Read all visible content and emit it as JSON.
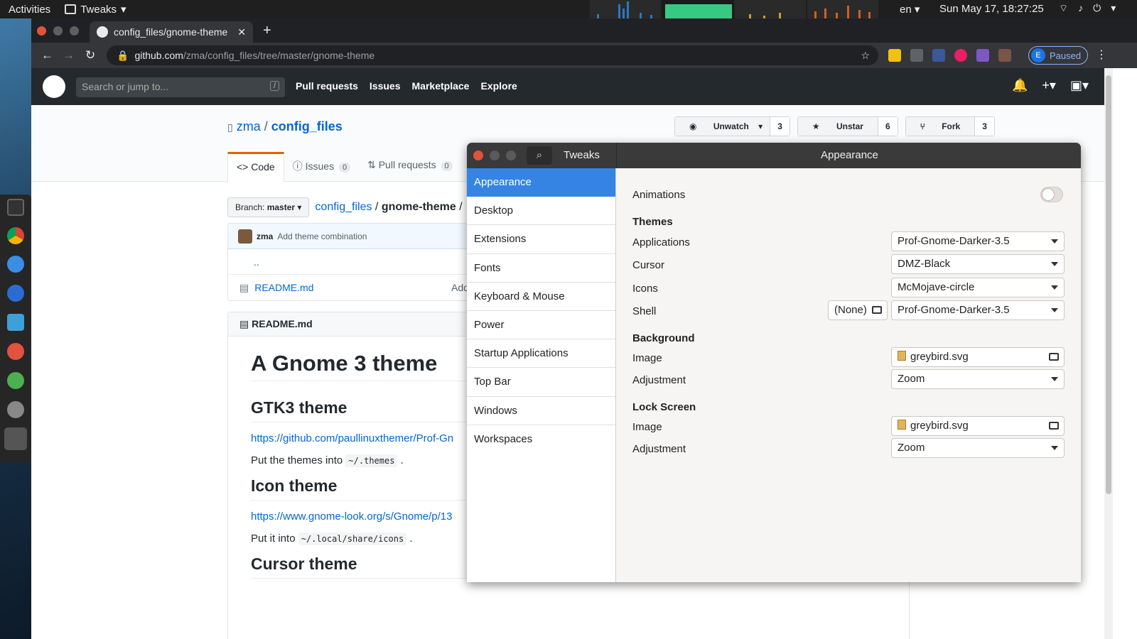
{
  "topbar": {
    "activities": "Activities",
    "app": "Tweaks",
    "lang": "en ▾",
    "clock": "Sun May 17, 18:27:25"
  },
  "chrome": {
    "tab_title": "config_files/gnome-theme",
    "url_host": "github.com",
    "url_path": "/zma/config_files/tree/master/gnome-theme",
    "profile_initial": "E",
    "profile_status": "Paused"
  },
  "github": {
    "search_placeholder": "Search or jump to...",
    "search_key": "/",
    "nav": [
      "Pull requests",
      "Issues",
      "Marketplace",
      "Explore"
    ],
    "owner": "zma",
    "repo": "config_files",
    "watch_label": "Unwatch",
    "watch_count": "3",
    "star_label": "Unstar",
    "star_count": "6",
    "fork_label": "Fork",
    "fork_count": "3",
    "tabs": [
      {
        "label": "Code",
        "count": ""
      },
      {
        "label": "Issues",
        "count": "0"
      },
      {
        "label": "Pull requests",
        "count": "0"
      }
    ],
    "branch_prefix": "Branch:",
    "branch": "master",
    "crumb_root": "config_files",
    "crumb_dir": "gnome-theme",
    "commit_author": "zma",
    "commit_msg": "Add theme combination",
    "parent_dir": "..",
    "file_name": "README.md",
    "file_msg": "Add",
    "readme_title": "README.md",
    "md": {
      "h1": "A Gnome 3 theme",
      "h2_gtk": "GTK3 theme",
      "gtk_link": "https://github.com/paullinuxthemer/Prof-Gn",
      "gtk_put": "Put the themes into",
      "gtk_path": "~/.themes",
      "h2_icon": "Icon theme",
      "icon_link": "https://www.gnome-look.org/s/Gnome/p/13",
      "icon_put": "Put it into",
      "icon_path": "~/.local/share/icons",
      "h2_cursor": "Cursor theme"
    }
  },
  "tweaks": {
    "app_title": "Tweaks",
    "page_title": "Appearance",
    "sidebar": [
      "Appearance",
      "Desktop",
      "Extensions",
      "Fonts",
      "Keyboard & Mouse",
      "Power",
      "Startup Applications",
      "Top Bar",
      "Windows",
      "Workspaces"
    ],
    "animations_label": "Animations",
    "animations_on": false,
    "themes_header": "Themes",
    "applications_label": "Applications",
    "applications_value": "Prof-Gnome-Darker-3.5",
    "cursor_label": "Cursor",
    "cursor_value": "DMZ-Black",
    "icons_label": "Icons",
    "icons_value": "McMojave-circle",
    "shell_label": "Shell",
    "shell_file": "(None)",
    "shell_value": "Prof-Gnome-Darker-3.5",
    "background_header": "Background",
    "bg_image_label": "Image",
    "bg_image_value": "greybird.svg",
    "bg_adjust_label": "Adjustment",
    "bg_adjust_value": "Zoom",
    "lock_header": "Lock Screen",
    "lock_image_label": "Image",
    "lock_image_value": "greybird.svg",
    "lock_adjust_label": "Adjustment",
    "lock_adjust_value": "Zoom"
  },
  "colors": {
    "accent": "#3584e4",
    "github_header": "#24292e",
    "link": "#0366d6"
  }
}
